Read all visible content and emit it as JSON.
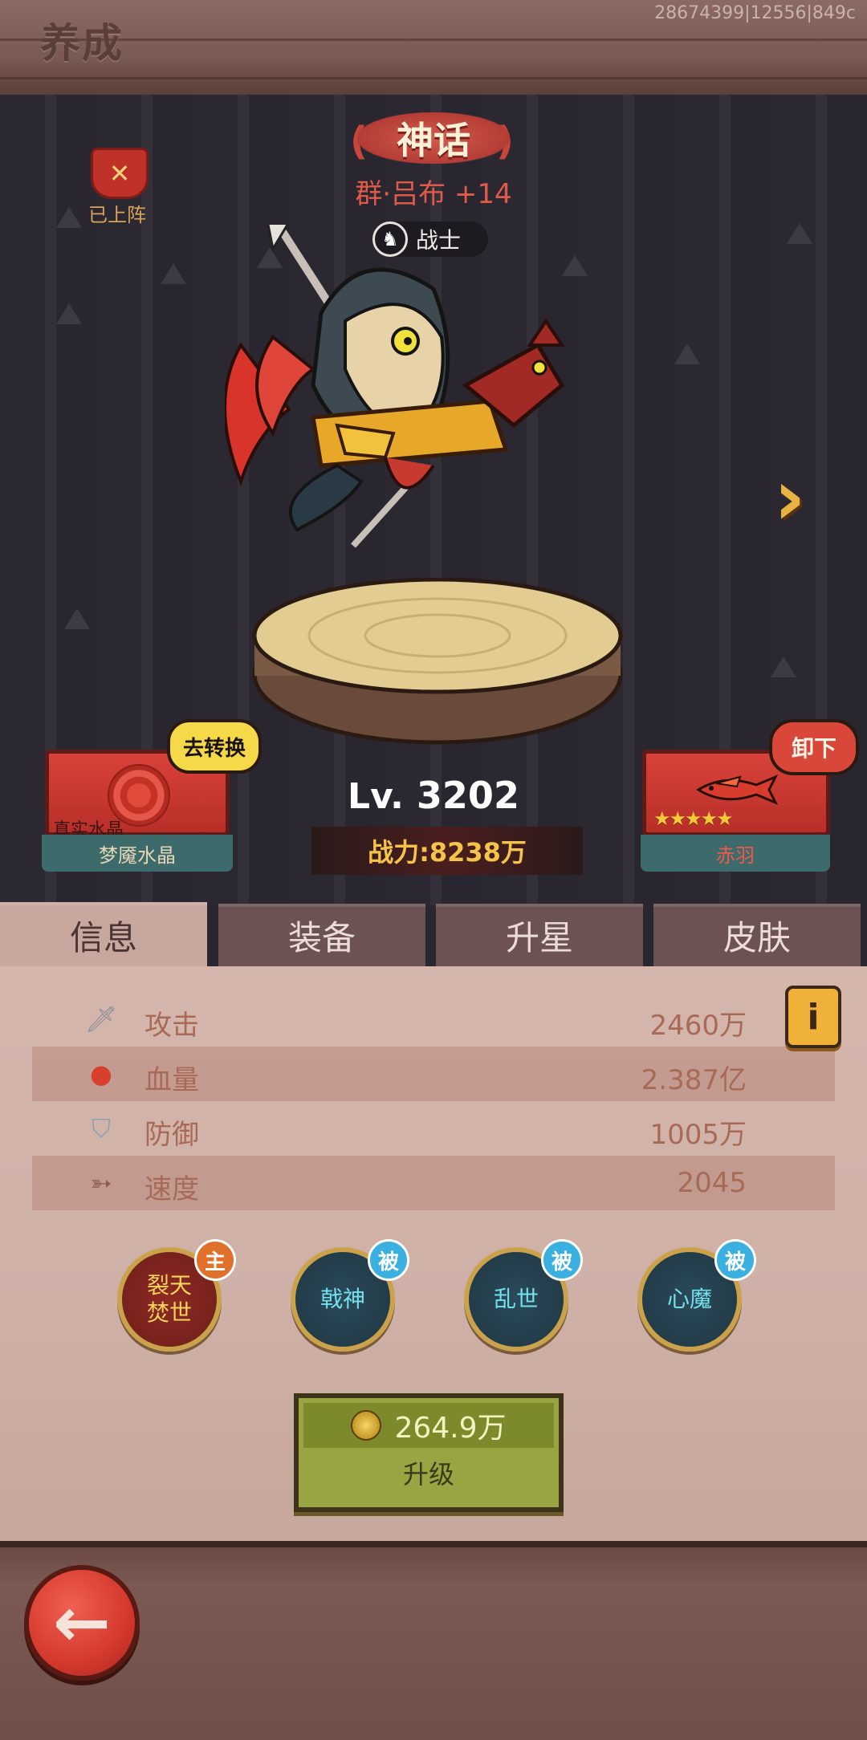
{
  "header": {
    "title": "养成",
    "id_text": "28674399|12556|849c"
  },
  "hero": {
    "rarity": "神话",
    "name": "群·吕布 +14",
    "class": "战士",
    "deployed_label": "已上阵",
    "level_prefix": "Lv.",
    "level": "3202",
    "power": "战力:8238万"
  },
  "crystal": {
    "sub_label": "真实水晶",
    "name": "梦魇水晶",
    "convert_button": "去转换"
  },
  "mount": {
    "name": "赤羽",
    "stars": 5,
    "unequip_button": "卸下"
  },
  "tabs": [
    {
      "label": "信息",
      "active": true
    },
    {
      "label": "装备",
      "active": false
    },
    {
      "label": "升星",
      "active": false
    },
    {
      "label": "皮肤",
      "active": false
    }
  ],
  "stats": [
    {
      "label": "攻击",
      "value": "2460万",
      "icon": "sword-icon"
    },
    {
      "label": "血量",
      "value": "2.387亿",
      "icon": "blood-drop-icon"
    },
    {
      "label": "防御",
      "value": "1005万",
      "icon": "shield-icon"
    },
    {
      "label": "速度",
      "value": "2045",
      "icon": "wing-speed-icon"
    }
  ],
  "skills": [
    {
      "name": "裂天\n焚世",
      "type": "main",
      "badge": "主"
    },
    {
      "name": "戟神",
      "type": "passive",
      "badge": "被"
    },
    {
      "name": "乱世",
      "type": "passive",
      "badge": "被"
    },
    {
      "name": "心魔",
      "type": "passive",
      "badge": "被"
    }
  ],
  "upgrade": {
    "cost": "264.9万",
    "label": "升级"
  },
  "icons": {
    "info": "i",
    "back": "back-arrow-icon",
    "next": "next-arrow-icon"
  }
}
